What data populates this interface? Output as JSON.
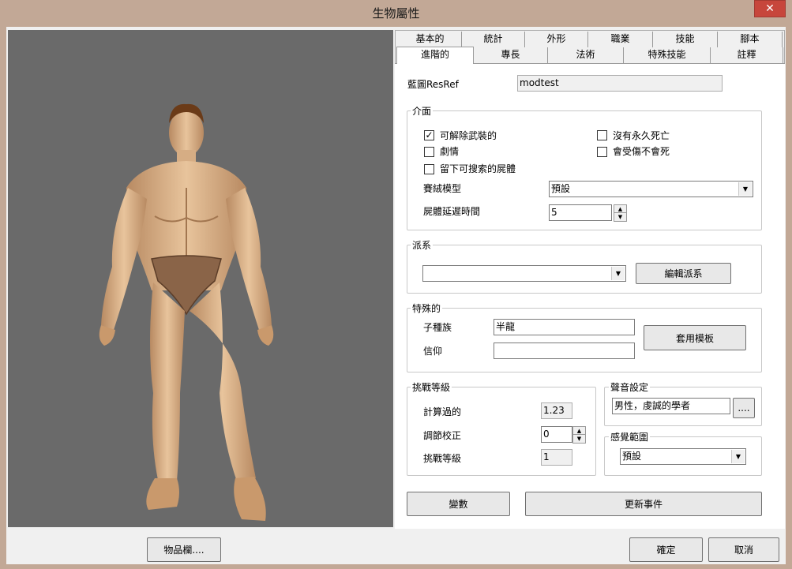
{
  "window": {
    "title": "生物屬性",
    "close_label": "✕"
  },
  "tabs_row1": [
    "基本的",
    "統計",
    "外形",
    "職業",
    "技能",
    "腳本"
  ],
  "tabs_row2": [
    "進階的",
    "專長",
    "法術",
    "特殊技能",
    "註釋"
  ],
  "blueprint": {
    "label": "藍圖ResRef",
    "value": "modtest"
  },
  "interface": {
    "title": "介面",
    "disarmable": {
      "label": "可解除武裝的",
      "checked": "✓"
    },
    "plot": {
      "label": "劇情",
      "checked": ""
    },
    "leave_corpse": {
      "label": "留下可搜索的屍體",
      "checked": ""
    },
    "no_perm_death": {
      "label": "沒有永久死亡",
      "checked": ""
    },
    "immortal": {
      "label": "會受傷不會死",
      "checked": ""
    },
    "remains_label": "賽絨模型",
    "remains_value": "預設",
    "corpse_decay_label": "屍體延遲時間",
    "corpse_decay_value": "5"
  },
  "faction": {
    "title": "派系",
    "value": "",
    "edit_button": "編輯派系"
  },
  "special": {
    "title": "特殊的",
    "subrace_label": "子種族",
    "subrace_value": "半龍",
    "deity_label": "信仰",
    "deity_value": "",
    "apply_template_button": "套用模板"
  },
  "challenge": {
    "title": "挑戰等級",
    "calculated_label": "計算過的",
    "calculated_value": "1.23",
    "adjust_label": "調節校正",
    "adjust_value": "0",
    "rating_label": "挑戰等級",
    "rating_value": "1"
  },
  "sound": {
    "title": "聲音設定",
    "value": "男性，虔誠的學者",
    "browse_label": "...."
  },
  "perception": {
    "title": "感覺範圍",
    "value": "預設"
  },
  "buttons": {
    "variables": "變數",
    "update_events": "更新事件",
    "inventory": "物品欄....",
    "ok": "確定",
    "cancel": "取消"
  },
  "icons": {
    "check": "checkmark-icon",
    "dropdown": "dropdown-arrow-icon",
    "close": "close-icon"
  }
}
